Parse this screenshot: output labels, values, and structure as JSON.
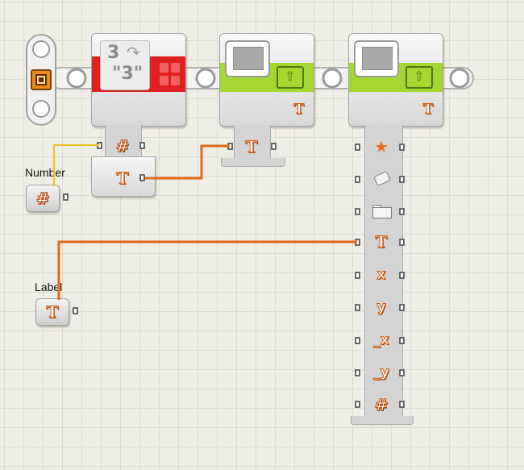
{
  "canvas": {
    "grid_color": "#dcdbd2",
    "background_color": "#efeee6"
  },
  "colors": {
    "number_wire": "#f0c020",
    "text_wire": "#e06a1a",
    "convert_red": "#e02020",
    "display_green": "#a6d630"
  },
  "start_block": {
    "icon": "start-square-icon"
  },
  "number_to_text_block": {
    "icon_line1": "3",
    "icon_line2": "\"3\"",
    "plugs": [
      {
        "glyph": "#"
      },
      {
        "glyph": "T"
      }
    ]
  },
  "text_block": {
    "corner_glyph": "T",
    "plugs": [
      {
        "glyph": "T"
      }
    ]
  },
  "display_block": {
    "corner_glyph": "T",
    "plugs": [
      {
        "glyph": "★",
        "icon": "star-icon"
      },
      {
        "glyph": "",
        "icon": "eraser-icon"
      },
      {
        "glyph": "",
        "icon": "folder-icon"
      },
      {
        "glyph": "T",
        "icon": "text-icon"
      },
      {
        "glyph": "x",
        "icon": "x-icon"
      },
      {
        "glyph": "y",
        "icon": "y-icon"
      },
      {
        "glyph": "_x",
        "icon": "end-x-icon"
      },
      {
        "glyph": "_y",
        "icon": "end-y-icon"
      },
      {
        "glyph": "#",
        "icon": "number-icon"
      }
    ]
  },
  "number_constant": {
    "label": "Number",
    "glyph": "#"
  },
  "label_constant": {
    "label": "Label",
    "glyph": "T"
  }
}
